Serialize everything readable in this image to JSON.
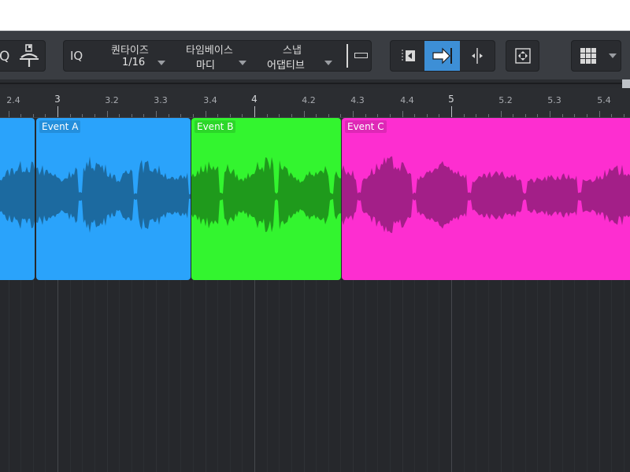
{
  "toolbar": {
    "q_label": "Q",
    "iq_label": "IQ",
    "quantize": {
      "title": "퀀타이즈",
      "value": "1/16"
    },
    "timebase": {
      "title": "타임베이스",
      "value": "마디"
    },
    "snap": {
      "title": "스냅",
      "value": "어댑티브"
    }
  },
  "ruler": {
    "labels": [
      "2.4",
      "3",
      "3.2",
      "3.3",
      "3.4",
      "4",
      "4.2",
      "4.3",
      "4.4",
      "5",
      "5.2",
      "5.3",
      "5.4"
    ],
    "major": [
      "3",
      "4",
      "5"
    ]
  },
  "events": [
    {
      "name": "",
      "color": "#2aa3fb",
      "wave_color": "#1c6aa0"
    },
    {
      "name": "Event A",
      "color": "#2aa3fb",
      "wave_color": "#1c6aa0"
    },
    {
      "name": "Event B",
      "color": "#33f52f",
      "wave_color": "#1f9a1c"
    },
    {
      "name": "Event C",
      "color": "#fd2ed0",
      "wave_color": "#a31f88"
    }
  ]
}
